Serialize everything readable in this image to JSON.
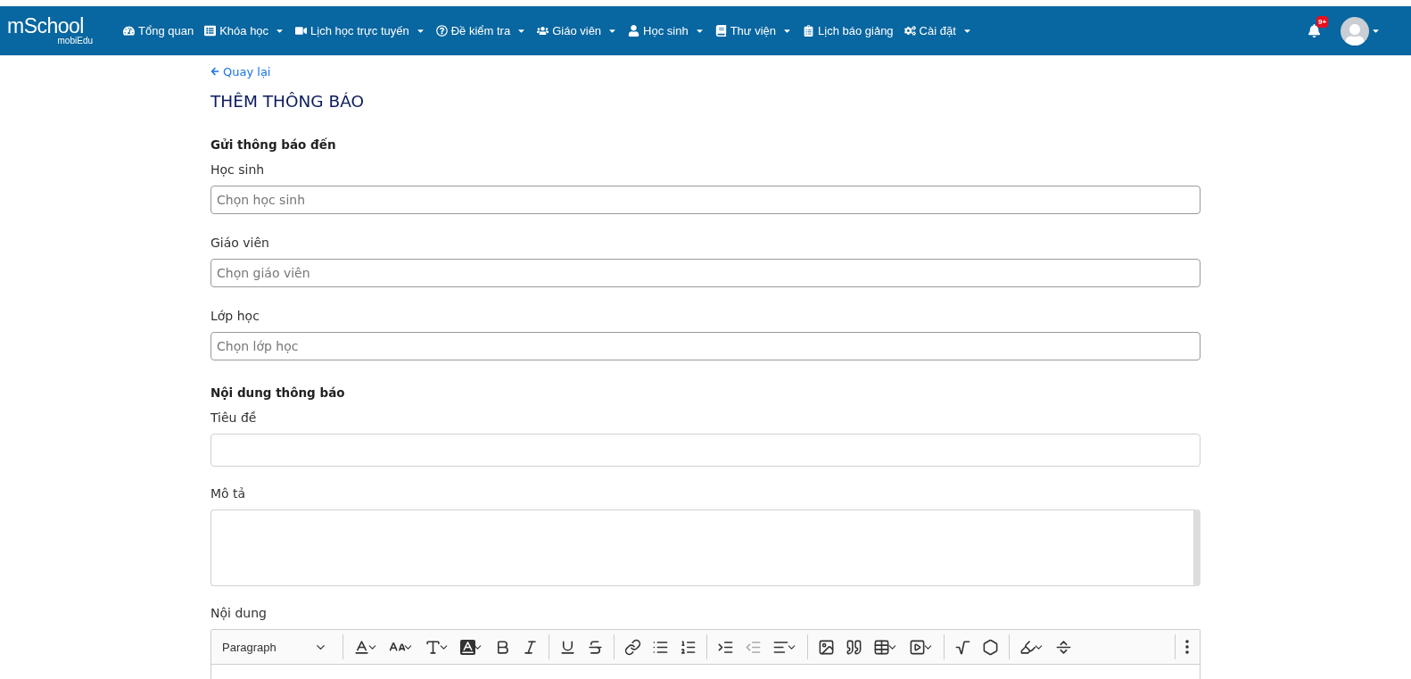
{
  "logo": {
    "main": "mSchool",
    "sub": "mobiEdu"
  },
  "nav": [
    {
      "label": "Tổng quan",
      "dropdown": false
    },
    {
      "label": "Khóa học",
      "dropdown": true
    },
    {
      "label": "Lịch học trực tuyến",
      "dropdown": true
    },
    {
      "label": "Đề kiểm tra",
      "dropdown": true
    },
    {
      "label": "Giáo viên",
      "dropdown": true
    },
    {
      "label": "Học sinh",
      "dropdown": true
    },
    {
      "label": "Thư viện",
      "dropdown": true
    },
    {
      "label": "Lịch báo giảng",
      "dropdown": false
    },
    {
      "label": "Cài đặt",
      "dropdown": true
    }
  ],
  "notifications": {
    "badge": "9+"
  },
  "back_link": "Quay lại",
  "page_title": "THÊM THÔNG BÁO",
  "sections": [
    {
      "heading": "Gửi thông báo đến",
      "fields": [
        {
          "kind": "select",
          "label": "Học sinh",
          "placeholder": "Chọn học sinh"
        },
        {
          "kind": "select",
          "label": "Giáo viên",
          "placeholder": "Chọn giáo viên"
        },
        {
          "kind": "select",
          "label": "Lớp học",
          "placeholder": "Chọn lớp học"
        }
      ]
    },
    {
      "heading": "Nội dung thông báo",
      "fields": [
        {
          "kind": "input",
          "label": "Tiêu đề"
        },
        {
          "kind": "textarea",
          "label": "Mô tả"
        },
        {
          "kind": "editor",
          "label": "Nội dung"
        }
      ]
    }
  ],
  "editor": {
    "format": "Paragraph",
    "outdent_disabled": true
  }
}
